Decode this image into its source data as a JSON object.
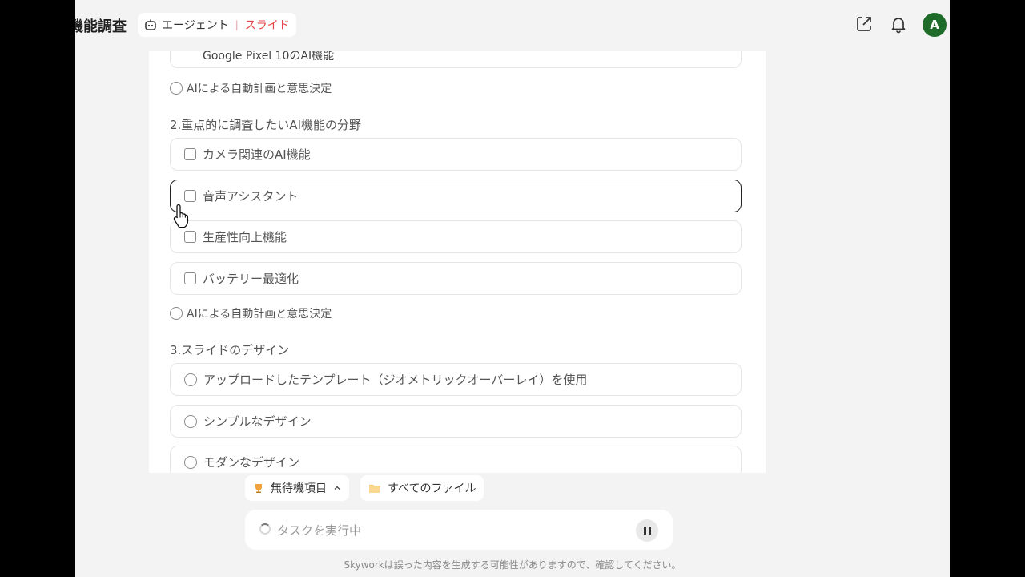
{
  "header": {
    "page_title": "機能調査",
    "mode_agent": "エージェント",
    "mode_slide": "スライド",
    "avatar_letter": "A",
    "icons": [
      "share-icon",
      "bell-icon"
    ]
  },
  "form": {
    "top_partial_value": "Google Pixel 10のAI機能",
    "q1_last_option": "AIによる自動計画と意思決定",
    "q2": {
      "title": "2.重点的に調査したいAI機能の分野",
      "options": [
        "カメラ関連のAI機能",
        "音声アシスタント",
        "生産性向上機能",
        "バッテリー最適化"
      ],
      "extra_option": "AIによる自動計画と意思決定"
    },
    "q3": {
      "title": "3.スライドのデザイン",
      "options": [
        "アップロードしたテンプレート（ジオメトリックオーバーレイ）を使用",
        "シンプルなデザイン",
        "モダンなデザイン"
      ]
    }
  },
  "bottom": {
    "pending_label": "無待機項目",
    "files_label": "すべてのファイル",
    "task_status": "タスクを実行中",
    "disclaimer": "Skyworkは誤った内容を生成する可能性がありますので、確認してください。"
  },
  "colors": {
    "accent_red": "#e64545",
    "avatar_green": "#1f6b2a"
  }
}
